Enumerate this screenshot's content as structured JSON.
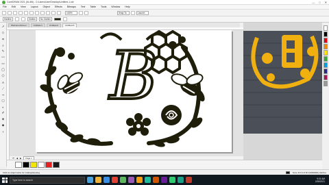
{
  "window": {
    "title": "CorelDRAW 2021 (64-Bit) - C:\\Users\\User\\Desktop\\Untitled-1.cdr",
    "controls": [
      "—",
      "□",
      "✕"
    ]
  },
  "menu": [
    "File",
    "Edit",
    "View",
    "Layout",
    "Object",
    "Effects",
    "Bitmaps",
    "Text",
    "Table",
    "Tools",
    "Window",
    "Help"
  ],
  "standard_toolbar": {
    "zoom": "100%",
    "snap": "Snap To",
    "launch": "Launch"
  },
  "property_bar": {
    "width_field": "Hairline",
    "outline_label": "Outline",
    "style_field": "No Outline"
  },
  "tabs": [
    "WelcomeScreen",
    "Untitled-1",
    "Untitled-2",
    "Untitled-3"
  ],
  "toolbox_icons": [
    "pick-icon",
    "shape-icon",
    "crop-icon",
    "zoom-icon",
    "freehand-icon",
    "artistic-icon",
    "rectangle-icon",
    "ellipse-icon",
    "polygon-icon",
    "text-icon",
    "parallel-icon",
    "connector-icon",
    "shadow-icon",
    "transparency-icon",
    "eyedropper-icon",
    "fill-icon",
    "smart-fill-icon",
    "plus-icon"
  ],
  "page_nav": {
    "label": "Page 1"
  },
  "doc_palette": {
    "colors": [
      "#ffffff",
      "#000000",
      "#f2e600",
      "#ffffff",
      "#e62020",
      "#1a1a1a"
    ]
  },
  "color_bar": {
    "colors": [
      "#ffffff",
      "#000000",
      "#e3000f",
      "#f28c00",
      "#ffe500",
      "#3aa935",
      "#009fe3",
      "#2b2a7f",
      "#a3195b",
      "#999999"
    ]
  },
  "status": {
    "left": "Click an object twice for rotating/skewing",
    "right": "None  R:0 G:0 B:0 (#000000)  Hairline"
  },
  "taskbar": {
    "search": "Type here to search",
    "time": "9:01 AM",
    "date": "2/28/2021",
    "icons": [
      "#4aa3df",
      "#f2b233",
      "#3a8ee6",
      "#e34133",
      "#5cb85c",
      "#9b59b6",
      "#f39c12",
      "#1abc9c",
      "#d35400",
      "#6a1b9a",
      "#2ecc71",
      "#16a085",
      "#c0392b"
    ]
  },
  "design": {
    "ink": "#1e1e0a",
    "monogram": "B",
    "photo_accent": "#f0b010",
    "photo_bg": "#4a4f58"
  }
}
